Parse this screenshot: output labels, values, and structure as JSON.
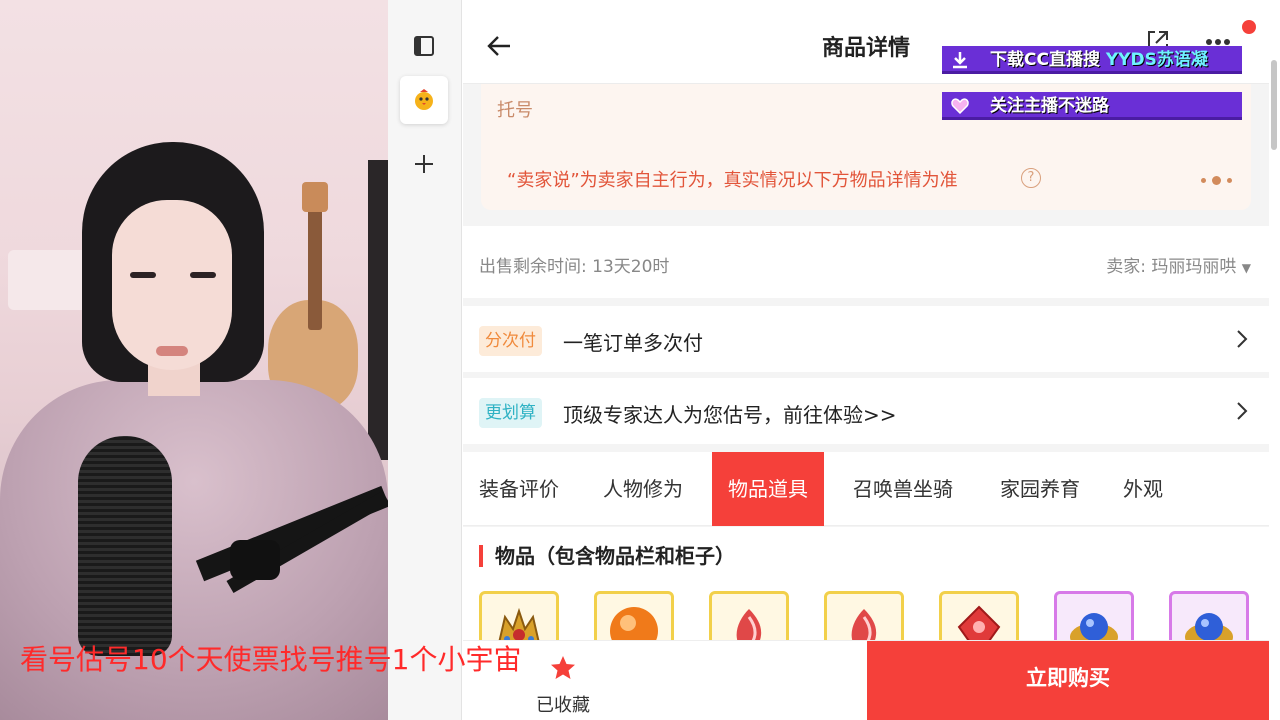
{
  "app": {
    "title": "商品详情"
  },
  "notice": {
    "title": "托号",
    "text": "“卖家说”为卖家自主行为，真实情况以下方物品详情为准",
    "help_icon": "?"
  },
  "info": {
    "remain_time": "出售剩余时间: 13天20时",
    "seller": "卖家: 玛丽玛丽哄"
  },
  "rows": [
    {
      "tag": "分次付",
      "text": "一笔订单多次付"
    },
    {
      "tag": "更划算",
      "text": "顶级专家达人为您估号，前往体验>>"
    }
  ],
  "tabs": [
    {
      "label": "装备评价"
    },
    {
      "label": "人物修为"
    },
    {
      "label": "物品道具",
      "active": true
    },
    {
      "label": "召唤兽坐骑"
    },
    {
      "label": "家园养育"
    },
    {
      "label": "外观"
    }
  ],
  "items_section": {
    "title": "物品（包含物品栏和柜子）"
  },
  "bottom": {
    "collect_label": "已收藏",
    "buy_label": "立即购买"
  },
  "overlays": {
    "download_prefix": "下载CC直播搜 ",
    "download_highlight": "YYDS苏语凝",
    "follow": "关注主播不迷路",
    "caption": "看号估号10个天使票找号推号1个小宇宙"
  },
  "colors": {
    "accent_red": "#f5403a",
    "notice_red": "#e2553a",
    "overlay_purple": "#6a2fd6"
  }
}
